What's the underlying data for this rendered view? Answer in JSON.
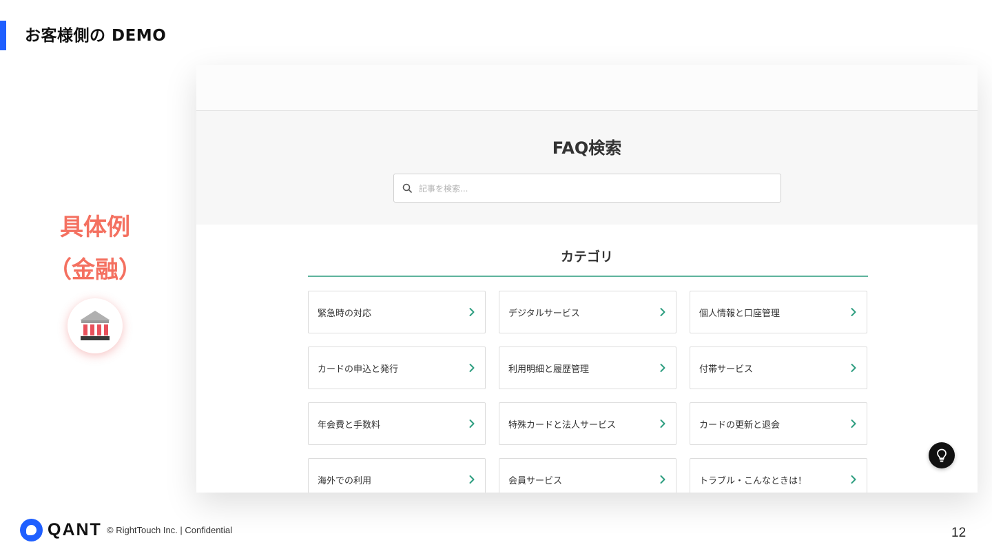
{
  "slide": {
    "title": "お客様側の DEMO",
    "example_label_line1": "具体例",
    "example_label_line2": "（金融）",
    "page_number": "12"
  },
  "footer": {
    "logo_text": "QANT",
    "copyright": "© RightTouch Inc.  |  Confidential"
  },
  "faq": {
    "title": "FAQ検索",
    "search_placeholder": "記事を検索...",
    "category_title": "カテゴリ",
    "categories": [
      {
        "label": "緊急時の対応"
      },
      {
        "label": "デジタルサービス"
      },
      {
        "label": "個人情報と口座管理"
      },
      {
        "label": "カードの申込と発行"
      },
      {
        "label": "利用明細と履歴管理"
      },
      {
        "label": "付帯サービス"
      },
      {
        "label": "年会費と手数料"
      },
      {
        "label": "特殊カードと法人サービス"
      },
      {
        "label": "カードの更新と退会"
      },
      {
        "label": "海外での利用"
      },
      {
        "label": "会員サービス"
      },
      {
        "label": "トラブル・こんなときは！"
      }
    ]
  },
  "icons": {
    "bank": "bank-icon",
    "search": "search-icon",
    "chevron": "chevron-right-icon",
    "hint": "lightbulb-icon"
  },
  "colors": {
    "accent_blue": "#1f5fff",
    "example_red": "#f47060",
    "category_underline": "#5eb39d",
    "chevron_green": "#2e9e80"
  }
}
